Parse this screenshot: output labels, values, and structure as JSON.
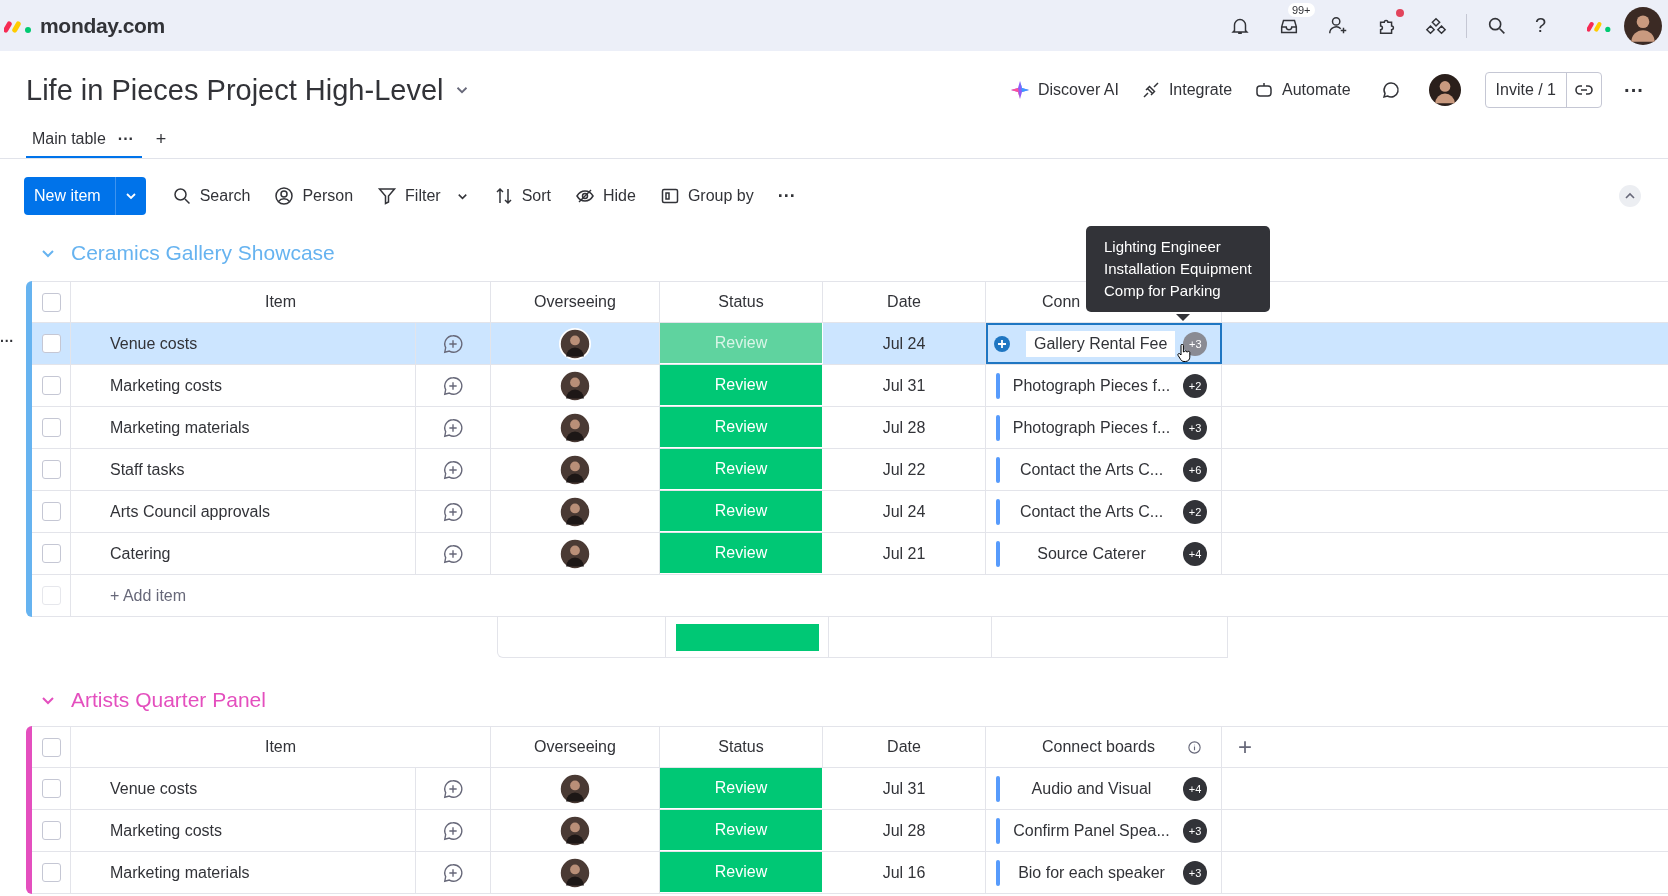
{
  "topbar": {
    "logo": "monday.com",
    "icons": [
      {
        "kind": "bell",
        "dot": false
      },
      {
        "kind": "inbox",
        "badge": "99+",
        "dot": false
      },
      {
        "kind": "person-add",
        "dot": false
      },
      {
        "kind": "puzzle",
        "dot": true
      },
      {
        "kind": "network",
        "dot": false
      }
    ],
    "help": "?"
  },
  "board": {
    "title": "Life in Pieces Project High-Level",
    "actions": [
      {
        "kind": "ai",
        "label": "Discover AI"
      },
      {
        "kind": "integrate",
        "label": "Integrate"
      },
      {
        "kind": "automate",
        "label": "Automate"
      }
    ],
    "invite": "Invite / 1",
    "more": "···"
  },
  "tabs": [
    {
      "label": "Main table",
      "selected": true,
      "more": "···"
    }
  ],
  "add_tab": "+",
  "toolbar": {
    "new_item": "New item",
    "tools": [
      {
        "kind": "search",
        "label": "Search",
        "caret": false
      },
      {
        "kind": "person",
        "label": "Person",
        "caret": false
      },
      {
        "kind": "filter",
        "label": "Filter",
        "caret": true
      },
      {
        "kind": "sort",
        "label": "Sort",
        "caret": false
      },
      {
        "kind": "hide",
        "label": "Hide",
        "caret": false
      },
      {
        "kind": "group",
        "label": "Group by",
        "caret": false
      }
    ],
    "more": "···"
  },
  "groups": [
    {
      "title": "Ceramics Gallery Showcase",
      "color": "#66b3f0",
      "all_checked": false,
      "columns": [
        "Item",
        "Overseeing",
        "Status",
        "Date",
        "Conn"
      ],
      "tooltip": [
        "Lighting Engineer",
        "Installation Equipment",
        "Comp for Parking"
      ],
      "rows": [
        {
          "item": "Venue costs",
          "status": "Review",
          "date": "Jul 24",
          "connect": "Gallery Rental Fee",
          "more": "+3",
          "selected": true,
          "checked": false,
          "menu": "···"
        },
        {
          "item": "Marketing costs",
          "status": "Review",
          "date": "Jul 31",
          "connect": "Photograph Pieces f...",
          "more": "+2",
          "selected": false,
          "checked": false
        },
        {
          "item": "Marketing materials",
          "status": "Review",
          "date": "Jul 28",
          "connect": "Photograph Pieces f...",
          "more": "+3",
          "selected": false,
          "checked": false
        },
        {
          "item": "Staff tasks",
          "status": "Review",
          "date": "Jul 22",
          "connect": "Contact the Arts C...",
          "more": "+6",
          "selected": false,
          "checked": false
        },
        {
          "item": "Arts Council approvals",
          "status": "Review",
          "date": "Jul 24",
          "connect": "Contact the Arts C...",
          "more": "+2",
          "selected": false,
          "checked": false
        },
        {
          "item": "Catering",
          "status": "Review",
          "date": "Jul 21",
          "connect": "Source Caterer",
          "more": "+4",
          "selected": false,
          "checked": false
        }
      ],
      "add_item": "+ Add item"
    },
    {
      "title": "Artists Quarter Panel",
      "color": "#e44fbe",
      "all_checked": false,
      "columns": [
        "Item",
        "Overseeing",
        "Status",
        "Date",
        "Connect boards"
      ],
      "add_column": "+",
      "rows": [
        {
          "item": "Venue costs",
          "status": "Review",
          "date": "Jul 31",
          "connect": "Audio and Visual",
          "more": "+4",
          "selected": false,
          "checked": false
        },
        {
          "item": "Marketing costs",
          "status": "Review",
          "date": "Jul 28",
          "connect": "Confirm Panel Spea...",
          "more": "+3",
          "selected": false,
          "checked": false
        },
        {
          "item": "Marketing materials",
          "status": "Review",
          "date": "Jul 16",
          "connect": "Bio for each speaker",
          "more": "+3",
          "selected": false,
          "checked": false
        }
      ]
    }
  ]
}
